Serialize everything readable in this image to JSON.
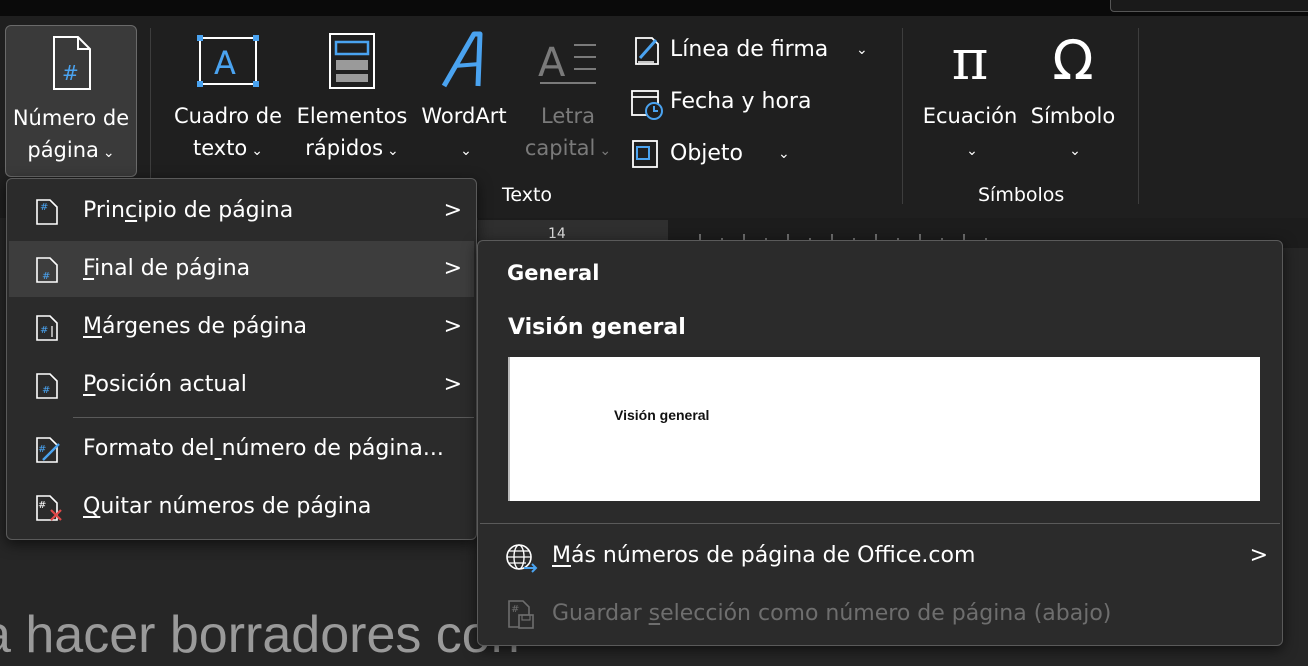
{
  "ribbon": {
    "page_number_btn": {
      "line1": "Número de",
      "line2": "página"
    },
    "text_box_btn": {
      "line1": "Cuadro de",
      "line2": "texto"
    },
    "quick_parts_btn": {
      "line1": "Elementos",
      "line2": "rápidos"
    },
    "wordart_btn": {
      "line1": "WordArt"
    },
    "drop_cap_btn": {
      "line1": "Letra",
      "line2": "capital"
    },
    "signature_line": "Línea de firma",
    "date_time": "Fecha y hora",
    "object": "Objeto",
    "text_group_label": "Texto",
    "equation_btn": "Ecuación",
    "symbol_btn": "Símbolo",
    "symbols_group_label": "Símbolos",
    "equation_glyph": "π",
    "symbol_glyph": "Ω",
    "ruler_number": "14"
  },
  "page_number_menu": {
    "items": [
      {
        "label": "Principio de página",
        "accel_index": 4
      },
      {
        "label": "Final de página",
        "accel_index": 0
      },
      {
        "label": "Márgenes de página",
        "accel_index": 0
      },
      {
        "label": "Posición actual",
        "accel_index": 0
      },
      {
        "label": "Formato del número de página...",
        "accel_index": 11
      },
      {
        "label": "Quitar números de página",
        "accel_index": 0
      }
    ]
  },
  "gallery": {
    "section_header": "General",
    "item_title": "Visión general",
    "preview_text": "Visión general",
    "more_online": "Más números de página de Office.com",
    "save_selection": "Guardar selección como número de página (abajo)"
  },
  "document": {
    "body_text": "a hacer borradores con"
  },
  "colors": {
    "accent": "#4aa3f0",
    "remove": "#e04848"
  }
}
